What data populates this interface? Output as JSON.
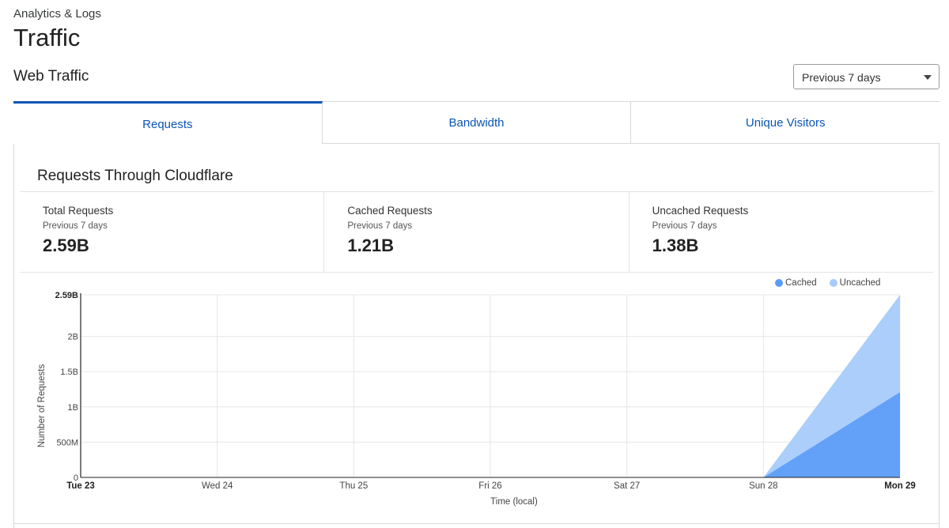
{
  "header": {
    "breadcrumb": "Analytics & Logs",
    "title": "Traffic",
    "section_title": "Web Traffic",
    "range_select": "Previous 7 days"
  },
  "tabs": [
    {
      "label": "Requests",
      "active": true
    },
    {
      "label": "Bandwidth",
      "active": false
    },
    {
      "label": "Unique Visitors",
      "active": false
    }
  ],
  "card": {
    "title": "Requests Through Cloudflare",
    "stats": [
      {
        "label": "Total Requests",
        "period": "Previous 7 days",
        "value": "2.59B"
      },
      {
        "label": "Cached Requests",
        "period": "Previous 7 days",
        "value": "1.21B"
      },
      {
        "label": "Uncached Requests",
        "period": "Previous 7 days",
        "value": "1.38B"
      }
    ]
  },
  "colors": {
    "accent": "#0a55b5",
    "cached": "#5b9bf8",
    "uncached": "#a7cbfb"
  },
  "chart_data": {
    "type": "area",
    "stacked": true,
    "xlabel": "Time (local)",
    "ylabel": "Number of Requests",
    "categories": [
      "Tue 23",
      "Wed 24",
      "Thu 25",
      "Fri 26",
      "Sat 27",
      "Sun 28",
      "Mon 29"
    ],
    "bold_ticks": [
      "Tue 23",
      "Mon 29"
    ],
    "y_ticks": [
      {
        "value": 0,
        "label": "0"
      },
      {
        "value": 500000000,
        "label": "500M"
      },
      {
        "value": 1000000000,
        "label": "1B"
      },
      {
        "value": 1500000000,
        "label": "1.5B"
      },
      {
        "value": 2000000000,
        "label": "2B"
      },
      {
        "value": 2590000000,
        "label": "2.59B"
      }
    ],
    "ylim": [
      0,
      2590000000
    ],
    "series": [
      {
        "name": "Cached",
        "values": [
          0,
          0,
          0,
          0,
          0,
          0,
          1210000000
        ]
      },
      {
        "name": "Uncached",
        "values": [
          0,
          0,
          0,
          0,
          0,
          0,
          1380000000
        ]
      }
    ],
    "grid": true,
    "legend_position": "top-right"
  }
}
